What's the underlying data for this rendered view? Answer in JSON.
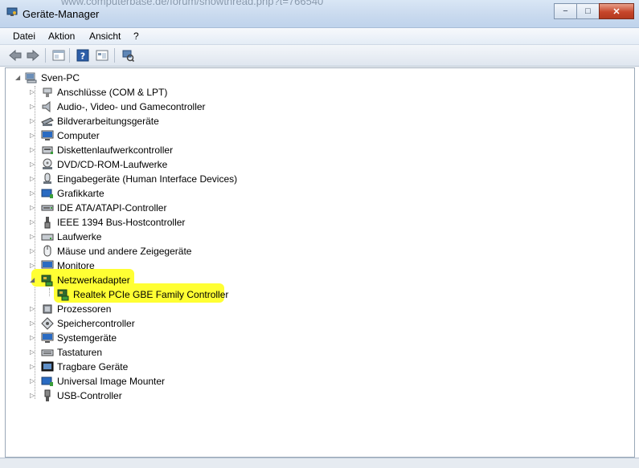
{
  "window": {
    "title": "Geräte-Manager",
    "background_url": "www.computerbase.de/forum/showthread.php?t=766540",
    "controls": {
      "minimize": "−",
      "maximize": "□",
      "close": "✕"
    }
  },
  "menu": [
    "Datei",
    "Aktion",
    "Ansicht",
    "?"
  ],
  "toolbar": {
    "buttons": [
      "back-icon",
      "forward-icon",
      "properties-icon",
      "help-icon",
      "view-icon",
      "scan-hardware-icon"
    ]
  },
  "tree": {
    "root": {
      "label": "Sven-PC",
      "icon": "computer-icon"
    },
    "items": [
      {
        "label": "Anschlüsse (COM & LPT)",
        "icon": "port-icon",
        "expanded": false
      },
      {
        "label": "Audio-, Video- und Gamecontroller",
        "icon": "speaker-icon",
        "expanded": false
      },
      {
        "label": "Bildverarbeitungsgeräte",
        "icon": "scanner-icon",
        "expanded": false
      },
      {
        "label": "Computer",
        "icon": "monitor-icon",
        "expanded": false
      },
      {
        "label": "Diskettenlaufwerkcontroller",
        "icon": "floppy-controller-icon",
        "expanded": false
      },
      {
        "label": "DVD/CD-ROM-Laufwerke",
        "icon": "dvd-drive-icon",
        "expanded": false
      },
      {
        "label": "Eingabegeräte (Human Interface Devices)",
        "icon": "hid-icon",
        "expanded": false
      },
      {
        "label": "Grafikkarte",
        "icon": "graphics-card-icon",
        "expanded": false
      },
      {
        "label": "IDE ATA/ATAPI-Controller",
        "icon": "ide-controller-icon",
        "expanded": false
      },
      {
        "label": "IEEE 1394 Bus-Hostcontroller",
        "icon": "firewire-icon",
        "expanded": false
      },
      {
        "label": "Laufwerke",
        "icon": "disk-drive-icon",
        "expanded": false
      },
      {
        "label": "Mäuse und andere Zeigegeräte",
        "icon": "mouse-icon",
        "expanded": false
      },
      {
        "label": "Monitore",
        "icon": "monitor-icon",
        "expanded": false
      },
      {
        "label": "Netzwerkadapter",
        "icon": "network-adapter-icon",
        "expanded": true,
        "highlighted": true,
        "children": [
          {
            "label": "Realtek PCIe GBE Family Controller",
            "icon": "network-adapter-icon",
            "highlighted": true
          }
        ]
      },
      {
        "label": "Prozessoren",
        "icon": "processor-icon",
        "expanded": false
      },
      {
        "label": "Speichercontroller",
        "icon": "storage-controller-icon",
        "expanded": false
      },
      {
        "label": "Systemgeräte",
        "icon": "system-devices-icon",
        "expanded": false
      },
      {
        "label": "Tastaturen",
        "icon": "keyboard-icon",
        "expanded": false
      },
      {
        "label": "Tragbare Geräte",
        "icon": "portable-device-icon",
        "expanded": false
      },
      {
        "label": "Universal Image Mounter",
        "icon": "image-mounter-icon",
        "expanded": false
      },
      {
        "label": "USB-Controller",
        "icon": "usb-icon",
        "expanded": false
      }
    ]
  },
  "colors": {
    "highlight": "#ffff33",
    "titlebar": "#c8d9ee",
    "close_button": "#c6462b"
  }
}
